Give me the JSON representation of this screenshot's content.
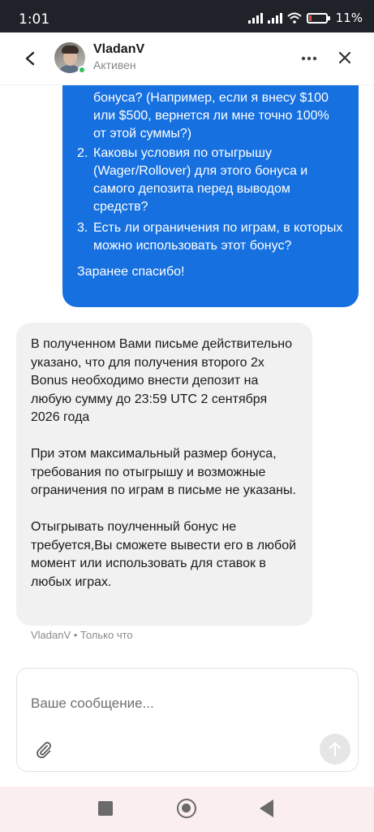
{
  "status_bar": {
    "time": "1:01",
    "battery": "11",
    "icons": [
      "signal-icon",
      "signal-icon",
      "wifi-icon",
      "battery-icon"
    ],
    "battery_low_color": "#e84a4a"
  },
  "header": {
    "name": "VladanV",
    "status": "Активен",
    "online_color": "#2fbf5b",
    "icons": [
      "back-arrow-icon",
      "more-icon",
      "close-icon"
    ]
  },
  "messages": {
    "outgoing": {
      "color": "#1670e0",
      "lead": "бонуса? (Например, если я внесу $100 или $500, вернется ли мне точно 100% от этой суммы?)",
      "items": [
        {
          "num": "2.",
          "text": "Каковы условия по отыгрышу (Wager/Rollover) для этого бонуса и самого депозита перед выводом средств?"
        },
        {
          "num": "3.",
          "text": "Есть ли ограничения по играм, в которых можно использовать этот бонус?"
        }
      ],
      "thanks": "Заранее спасибо!"
    },
    "incoming": {
      "color": "#f1f1f1",
      "paragraphs": [
        "В полученном Вами письме действительно указано, что для получения второго 2x Bonus необходимо внести депозит на любую сумму до 23:59 UTC 2 сентября 2026 года",
        "При этом максимальный размер бонуса, требования по отыгрышу и возможные ограничения по играм в письме не указаны.",
        "Отыгрывать поулченный бонус не требуется,Вы сможете вывести его в любой момент или использовать для ставок в любых играх."
      ],
      "meta": "VladanV • Только что"
    }
  },
  "composer": {
    "placeholder": "Ваше сообщение...",
    "value": "",
    "icons": [
      "paperclip-icon",
      "send-arrow-icon"
    ]
  },
  "nav_bar": {
    "icons": [
      "recent-apps-icon",
      "home-icon",
      "back-icon"
    ]
  }
}
